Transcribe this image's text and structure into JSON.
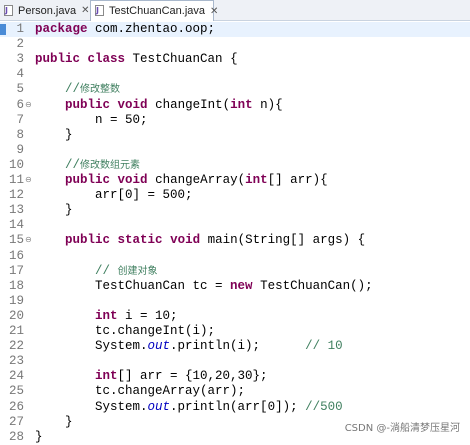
{
  "tabs": [
    {
      "label": "Person.java",
      "active": false
    },
    {
      "label": "TestChuanCan.java",
      "active": true
    }
  ],
  "editor": {
    "lines": [
      {
        "num": "1",
        "cur": true,
        "fold": "",
        "indent": "",
        "tokens": [
          {
            "t": "package",
            "c": "kw"
          },
          {
            "t": " com.zhentao.oop;",
            "c": ""
          }
        ]
      },
      {
        "num": "2",
        "fold": "",
        "indent": "",
        "tokens": []
      },
      {
        "num": "3",
        "fold": "",
        "indent": "",
        "tokens": [
          {
            "t": "public",
            "c": "kw"
          },
          {
            "t": " ",
            "c": ""
          },
          {
            "t": "class",
            "c": "kw"
          },
          {
            "t": " TestChuanCan {",
            "c": ""
          }
        ]
      },
      {
        "num": "4",
        "fold": "",
        "indent": "",
        "tokens": []
      },
      {
        "num": "5",
        "fold": "",
        "indent": "    ",
        "tokens": [
          {
            "t": "//",
            "c": "cm"
          },
          {
            "t": "修改整数",
            "c": "cmz"
          }
        ]
      },
      {
        "num": "6",
        "fold": "⊖",
        "indent": "    ",
        "tokens": [
          {
            "t": "public",
            "c": "kw"
          },
          {
            "t": " ",
            "c": ""
          },
          {
            "t": "void",
            "c": "kw"
          },
          {
            "t": " changeInt(",
            "c": ""
          },
          {
            "t": "int",
            "c": "kw"
          },
          {
            "t": " n){",
            "c": ""
          }
        ]
      },
      {
        "num": "7",
        "fold": "",
        "indent": "        ",
        "tokens": [
          {
            "t": "n = 50;",
            "c": ""
          }
        ]
      },
      {
        "num": "8",
        "fold": "",
        "indent": "    ",
        "tokens": [
          {
            "t": "}",
            "c": ""
          }
        ]
      },
      {
        "num": "9",
        "fold": "",
        "indent": "",
        "tokens": []
      },
      {
        "num": "10",
        "fold": "",
        "indent": "    ",
        "tokens": [
          {
            "t": "//",
            "c": "cm"
          },
          {
            "t": "修改数组元素",
            "c": "cmz"
          }
        ]
      },
      {
        "num": "11",
        "fold": "⊖",
        "indent": "    ",
        "tokens": [
          {
            "t": "public",
            "c": "kw"
          },
          {
            "t": " ",
            "c": ""
          },
          {
            "t": "void",
            "c": "kw"
          },
          {
            "t": " changeArray(",
            "c": ""
          },
          {
            "t": "int",
            "c": "kw"
          },
          {
            "t": "[] arr){",
            "c": ""
          }
        ]
      },
      {
        "num": "12",
        "fold": "",
        "indent": "        ",
        "tokens": [
          {
            "t": "arr[0] = 500;",
            "c": ""
          }
        ]
      },
      {
        "num": "13",
        "fold": "",
        "indent": "    ",
        "tokens": [
          {
            "t": "}",
            "c": ""
          }
        ]
      },
      {
        "num": "14",
        "fold": "",
        "indent": "",
        "tokens": []
      },
      {
        "num": "15",
        "fold": "⊖",
        "indent": "    ",
        "tokens": [
          {
            "t": "public",
            "c": "kw"
          },
          {
            "t": " ",
            "c": ""
          },
          {
            "t": "static",
            "c": "kw"
          },
          {
            "t": " ",
            "c": ""
          },
          {
            "t": "void",
            "c": "kw"
          },
          {
            "t": " main(String[] args) {",
            "c": ""
          }
        ]
      },
      {
        "num": "16",
        "fold": "",
        "indent": "",
        "tokens": []
      },
      {
        "num": "17",
        "fold": "",
        "indent": "        ",
        "tokens": [
          {
            "t": "// ",
            "c": "cm"
          },
          {
            "t": "创建对象",
            "c": "cmz"
          }
        ]
      },
      {
        "num": "18",
        "fold": "",
        "indent": "        ",
        "tokens": [
          {
            "t": "TestChuanCan tc = ",
            "c": ""
          },
          {
            "t": "new",
            "c": "kw"
          },
          {
            "t": " TestChuanCan();",
            "c": ""
          }
        ]
      },
      {
        "num": "19",
        "fold": "",
        "indent": "",
        "tokens": []
      },
      {
        "num": "20",
        "fold": "",
        "indent": "        ",
        "tokens": [
          {
            "t": "int",
            "c": "kw"
          },
          {
            "t": " i = 10;",
            "c": ""
          }
        ]
      },
      {
        "num": "21",
        "fold": "",
        "indent": "        ",
        "tokens": [
          {
            "t": "tc.changeInt(i);",
            "c": ""
          }
        ]
      },
      {
        "num": "22",
        "fold": "",
        "indent": "        ",
        "tokens": [
          {
            "t": "System.",
            "c": ""
          },
          {
            "t": "out",
            "c": "st"
          },
          {
            "t": ".println(i);      ",
            "c": ""
          },
          {
            "t": "// 10",
            "c": "cm"
          }
        ]
      },
      {
        "num": "23",
        "fold": "",
        "indent": "",
        "tokens": []
      },
      {
        "num": "24",
        "fold": "",
        "indent": "        ",
        "tokens": [
          {
            "t": "int",
            "c": "kw"
          },
          {
            "t": "[] arr = {10,20,30};",
            "c": ""
          }
        ]
      },
      {
        "num": "25",
        "fold": "",
        "indent": "        ",
        "tokens": [
          {
            "t": "tc.changeArray(arr);",
            "c": ""
          }
        ]
      },
      {
        "num": "26",
        "fold": "",
        "indent": "        ",
        "tokens": [
          {
            "t": "System.",
            "c": ""
          },
          {
            "t": "out",
            "c": "st"
          },
          {
            "t": ".println(arr[0]); ",
            "c": ""
          },
          {
            "t": "//500",
            "c": "cm"
          }
        ]
      },
      {
        "num": "27",
        "fold": "",
        "indent": "    ",
        "tokens": [
          {
            "t": "}",
            "c": ""
          }
        ]
      },
      {
        "num": "28",
        "fold": "",
        "indent": "",
        "tokens": [
          {
            "t": "}",
            "c": ""
          }
        ]
      }
    ]
  },
  "watermark": "CSDN @-淌船清梦压星河"
}
